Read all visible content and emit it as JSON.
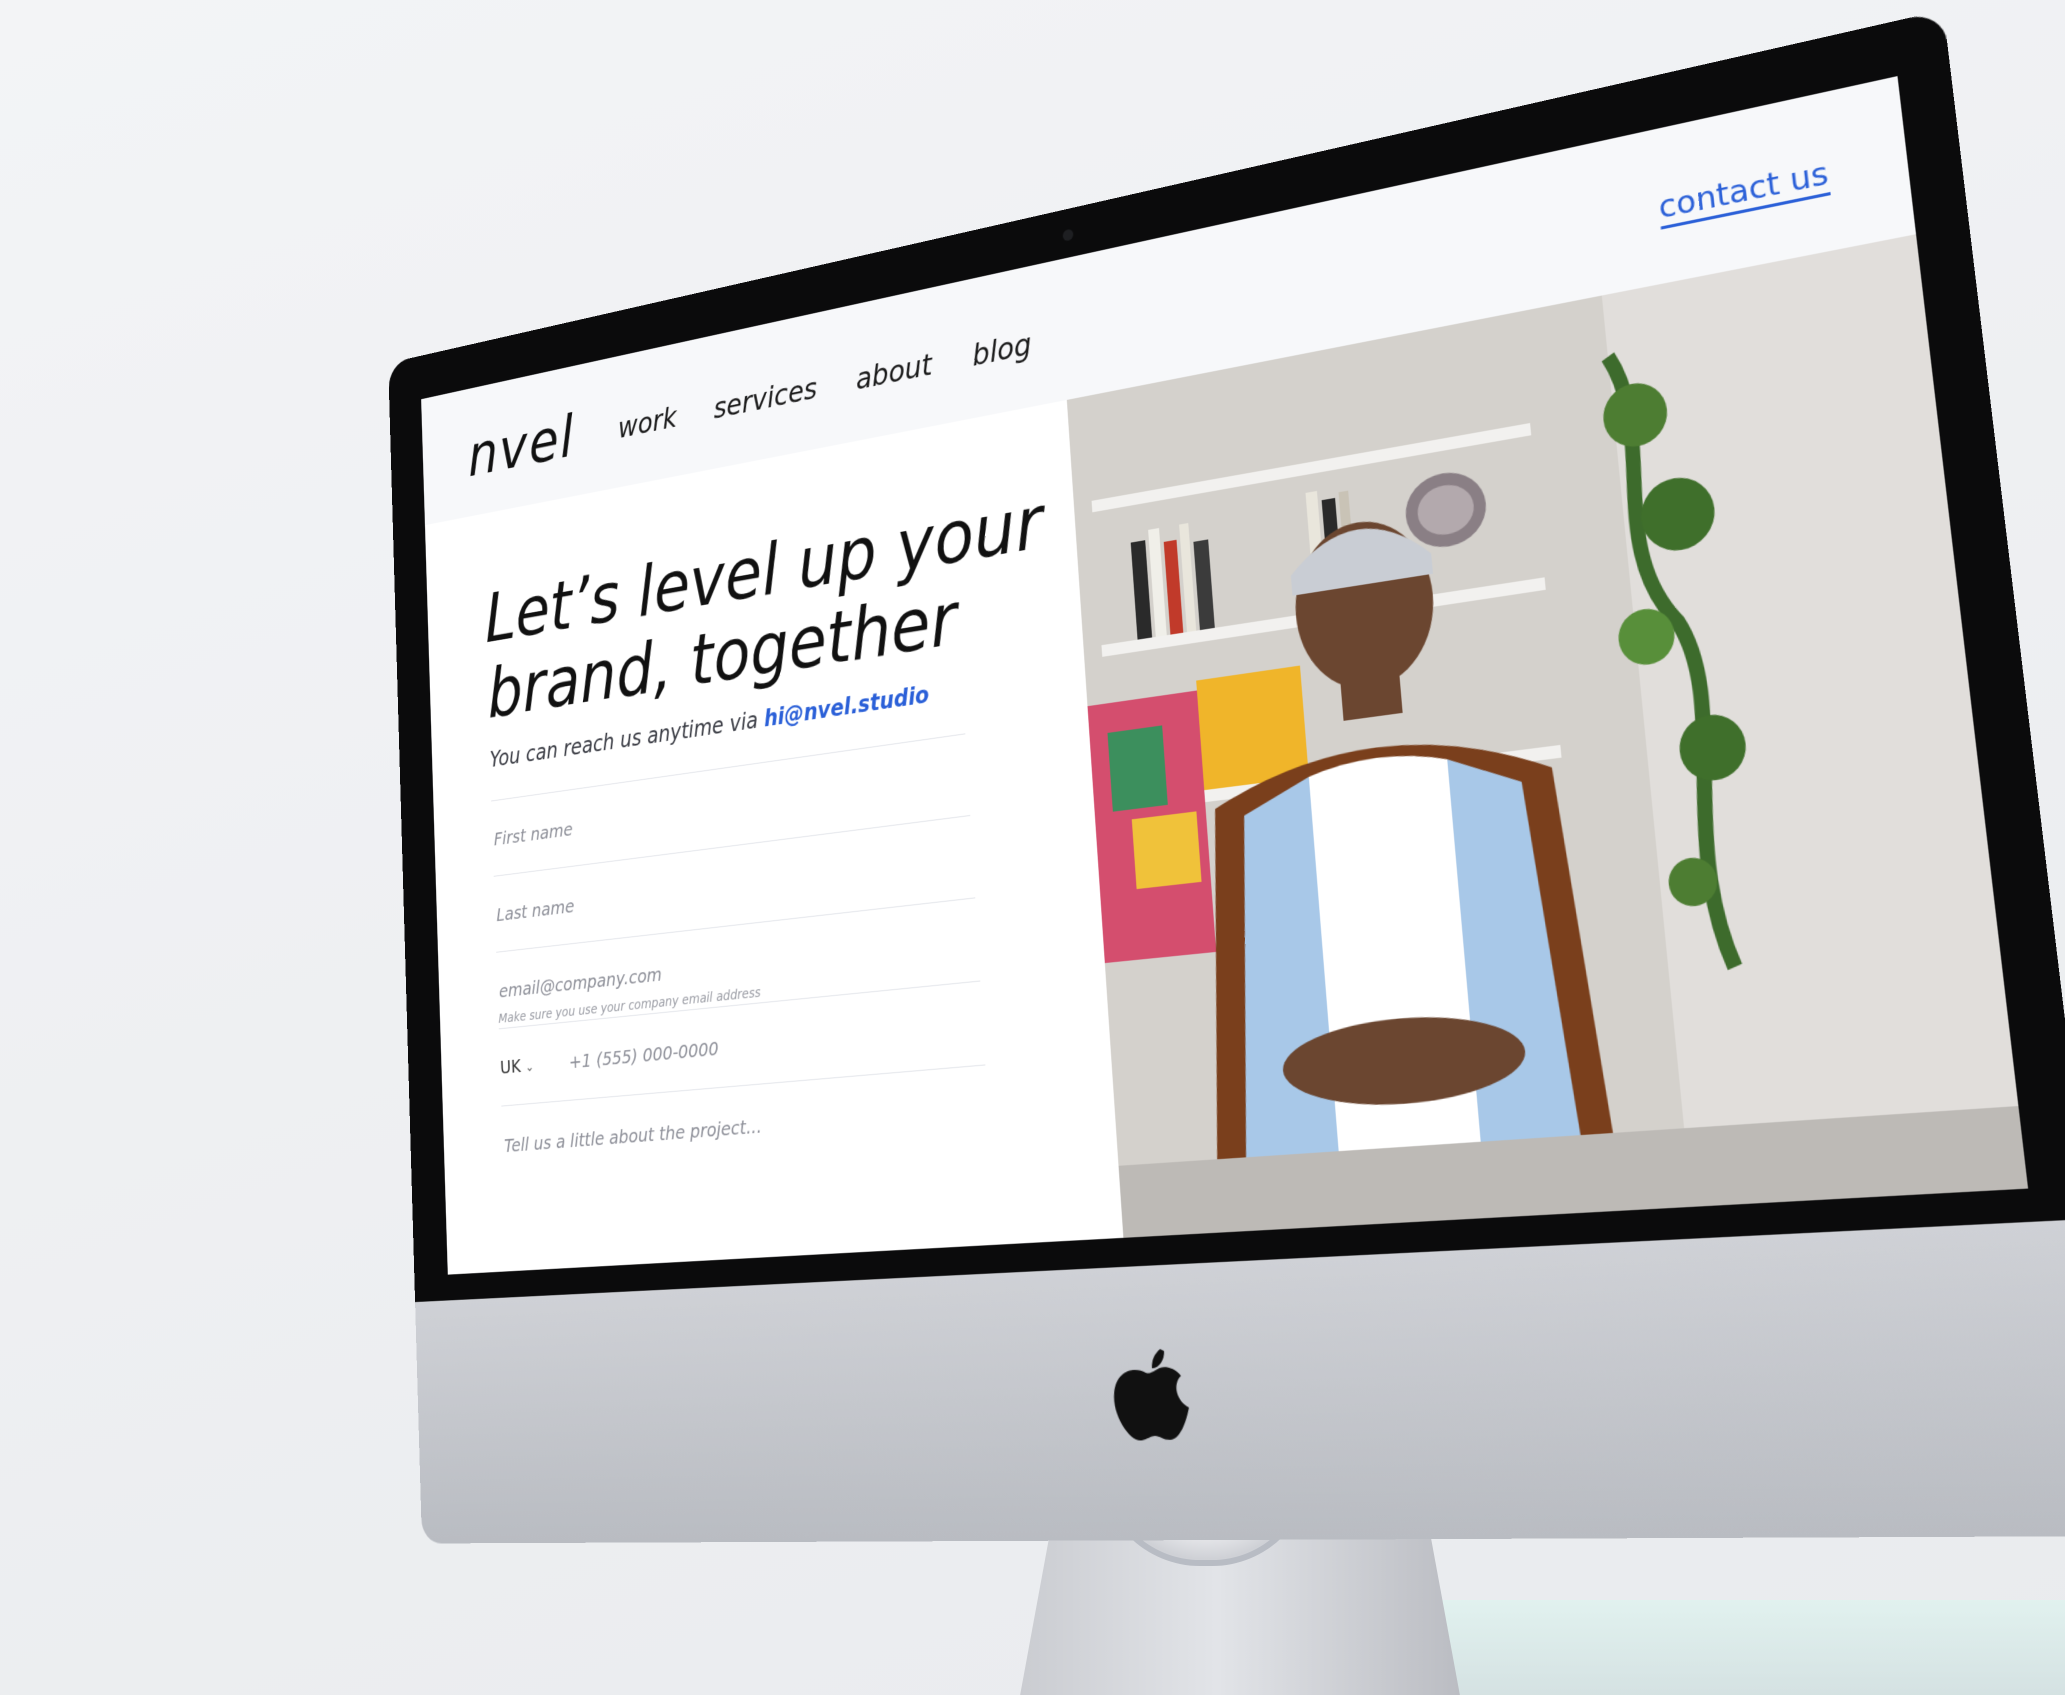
{
  "site": {
    "logo": "nvel",
    "nav": [
      "work",
      "services",
      "about",
      "blog"
    ],
    "contact_label": "contact us"
  },
  "hero": {
    "headline_line1": "Let’s level up your",
    "headline_line2": "brand, together",
    "reach_text": "You can reach us anytime via",
    "reach_email": "hi@nvel.studio"
  },
  "form": {
    "first_name_placeholder": "First name",
    "last_name_placeholder": "Last name",
    "email_placeholder": "email@company.com",
    "email_hint": "Make sure you use your company email address",
    "country_code": "UK",
    "phone_placeholder": "+1 (555) 000-0000",
    "message_placeholder": "Tell us a little about the project..."
  },
  "colors": {
    "accent": "#2b60d8",
    "text": "#111111",
    "bezel": "#0b0b0c",
    "chin": "#c4c6cb"
  },
  "icons": {
    "country_dropdown": "chevron-down-icon",
    "brand_mark": "apple-icon"
  }
}
